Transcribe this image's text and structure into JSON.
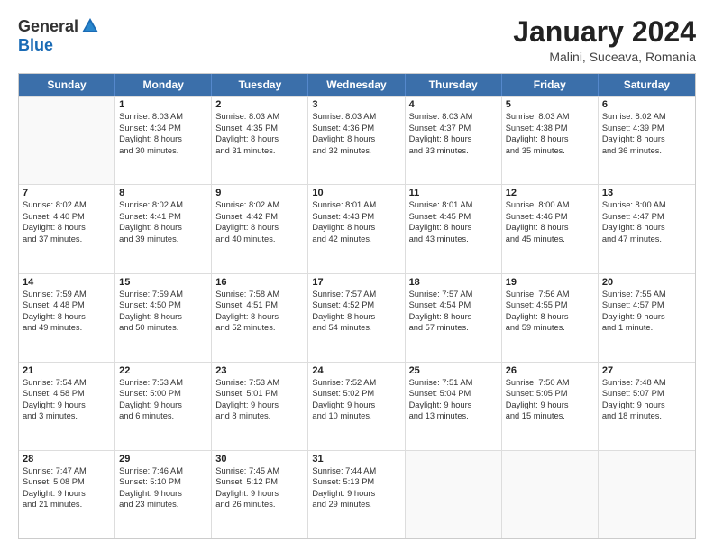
{
  "header": {
    "logo": {
      "general": "General",
      "blue": "Blue"
    },
    "title": "January 2024",
    "subtitle": "Malini, Suceava, Romania"
  },
  "weekdays": [
    "Sunday",
    "Monday",
    "Tuesday",
    "Wednesday",
    "Thursday",
    "Friday",
    "Saturday"
  ],
  "rows": [
    [
      {
        "day": "",
        "lines": [],
        "empty": true
      },
      {
        "day": "1",
        "lines": [
          "Sunrise: 8:03 AM",
          "Sunset: 4:34 PM",
          "Daylight: 8 hours",
          "and 30 minutes."
        ]
      },
      {
        "day": "2",
        "lines": [
          "Sunrise: 8:03 AM",
          "Sunset: 4:35 PM",
          "Daylight: 8 hours",
          "and 31 minutes."
        ]
      },
      {
        "day": "3",
        "lines": [
          "Sunrise: 8:03 AM",
          "Sunset: 4:36 PM",
          "Daylight: 8 hours",
          "and 32 minutes."
        ]
      },
      {
        "day": "4",
        "lines": [
          "Sunrise: 8:03 AM",
          "Sunset: 4:37 PM",
          "Daylight: 8 hours",
          "and 33 minutes."
        ]
      },
      {
        "day": "5",
        "lines": [
          "Sunrise: 8:03 AM",
          "Sunset: 4:38 PM",
          "Daylight: 8 hours",
          "and 35 minutes."
        ]
      },
      {
        "day": "6",
        "lines": [
          "Sunrise: 8:02 AM",
          "Sunset: 4:39 PM",
          "Daylight: 8 hours",
          "and 36 minutes."
        ]
      }
    ],
    [
      {
        "day": "7",
        "lines": [
          "Sunrise: 8:02 AM",
          "Sunset: 4:40 PM",
          "Daylight: 8 hours",
          "and 37 minutes."
        ]
      },
      {
        "day": "8",
        "lines": [
          "Sunrise: 8:02 AM",
          "Sunset: 4:41 PM",
          "Daylight: 8 hours",
          "and 39 minutes."
        ]
      },
      {
        "day": "9",
        "lines": [
          "Sunrise: 8:02 AM",
          "Sunset: 4:42 PM",
          "Daylight: 8 hours",
          "and 40 minutes."
        ]
      },
      {
        "day": "10",
        "lines": [
          "Sunrise: 8:01 AM",
          "Sunset: 4:43 PM",
          "Daylight: 8 hours",
          "and 42 minutes."
        ]
      },
      {
        "day": "11",
        "lines": [
          "Sunrise: 8:01 AM",
          "Sunset: 4:45 PM",
          "Daylight: 8 hours",
          "and 43 minutes."
        ]
      },
      {
        "day": "12",
        "lines": [
          "Sunrise: 8:00 AM",
          "Sunset: 4:46 PM",
          "Daylight: 8 hours",
          "and 45 minutes."
        ]
      },
      {
        "day": "13",
        "lines": [
          "Sunrise: 8:00 AM",
          "Sunset: 4:47 PM",
          "Daylight: 8 hours",
          "and 47 minutes."
        ]
      }
    ],
    [
      {
        "day": "14",
        "lines": [
          "Sunrise: 7:59 AM",
          "Sunset: 4:48 PM",
          "Daylight: 8 hours",
          "and 49 minutes."
        ]
      },
      {
        "day": "15",
        "lines": [
          "Sunrise: 7:59 AM",
          "Sunset: 4:50 PM",
          "Daylight: 8 hours",
          "and 50 minutes."
        ]
      },
      {
        "day": "16",
        "lines": [
          "Sunrise: 7:58 AM",
          "Sunset: 4:51 PM",
          "Daylight: 8 hours",
          "and 52 minutes."
        ]
      },
      {
        "day": "17",
        "lines": [
          "Sunrise: 7:57 AM",
          "Sunset: 4:52 PM",
          "Daylight: 8 hours",
          "and 54 minutes."
        ]
      },
      {
        "day": "18",
        "lines": [
          "Sunrise: 7:57 AM",
          "Sunset: 4:54 PM",
          "Daylight: 8 hours",
          "and 57 minutes."
        ]
      },
      {
        "day": "19",
        "lines": [
          "Sunrise: 7:56 AM",
          "Sunset: 4:55 PM",
          "Daylight: 8 hours",
          "and 59 minutes."
        ]
      },
      {
        "day": "20",
        "lines": [
          "Sunrise: 7:55 AM",
          "Sunset: 4:57 PM",
          "Daylight: 9 hours",
          "and 1 minute."
        ]
      }
    ],
    [
      {
        "day": "21",
        "lines": [
          "Sunrise: 7:54 AM",
          "Sunset: 4:58 PM",
          "Daylight: 9 hours",
          "and 3 minutes."
        ]
      },
      {
        "day": "22",
        "lines": [
          "Sunrise: 7:53 AM",
          "Sunset: 5:00 PM",
          "Daylight: 9 hours",
          "and 6 minutes."
        ]
      },
      {
        "day": "23",
        "lines": [
          "Sunrise: 7:53 AM",
          "Sunset: 5:01 PM",
          "Daylight: 9 hours",
          "and 8 minutes."
        ]
      },
      {
        "day": "24",
        "lines": [
          "Sunrise: 7:52 AM",
          "Sunset: 5:02 PM",
          "Daylight: 9 hours",
          "and 10 minutes."
        ]
      },
      {
        "day": "25",
        "lines": [
          "Sunrise: 7:51 AM",
          "Sunset: 5:04 PM",
          "Daylight: 9 hours",
          "and 13 minutes."
        ]
      },
      {
        "day": "26",
        "lines": [
          "Sunrise: 7:50 AM",
          "Sunset: 5:05 PM",
          "Daylight: 9 hours",
          "and 15 minutes."
        ]
      },
      {
        "day": "27",
        "lines": [
          "Sunrise: 7:48 AM",
          "Sunset: 5:07 PM",
          "Daylight: 9 hours",
          "and 18 minutes."
        ]
      }
    ],
    [
      {
        "day": "28",
        "lines": [
          "Sunrise: 7:47 AM",
          "Sunset: 5:08 PM",
          "Daylight: 9 hours",
          "and 21 minutes."
        ]
      },
      {
        "day": "29",
        "lines": [
          "Sunrise: 7:46 AM",
          "Sunset: 5:10 PM",
          "Daylight: 9 hours",
          "and 23 minutes."
        ]
      },
      {
        "day": "30",
        "lines": [
          "Sunrise: 7:45 AM",
          "Sunset: 5:12 PM",
          "Daylight: 9 hours",
          "and 26 minutes."
        ]
      },
      {
        "day": "31",
        "lines": [
          "Sunrise: 7:44 AM",
          "Sunset: 5:13 PM",
          "Daylight: 9 hours",
          "and 29 minutes."
        ]
      },
      {
        "day": "",
        "lines": [],
        "empty": true
      },
      {
        "day": "",
        "lines": [],
        "empty": true
      },
      {
        "day": "",
        "lines": [],
        "empty": true
      }
    ]
  ]
}
